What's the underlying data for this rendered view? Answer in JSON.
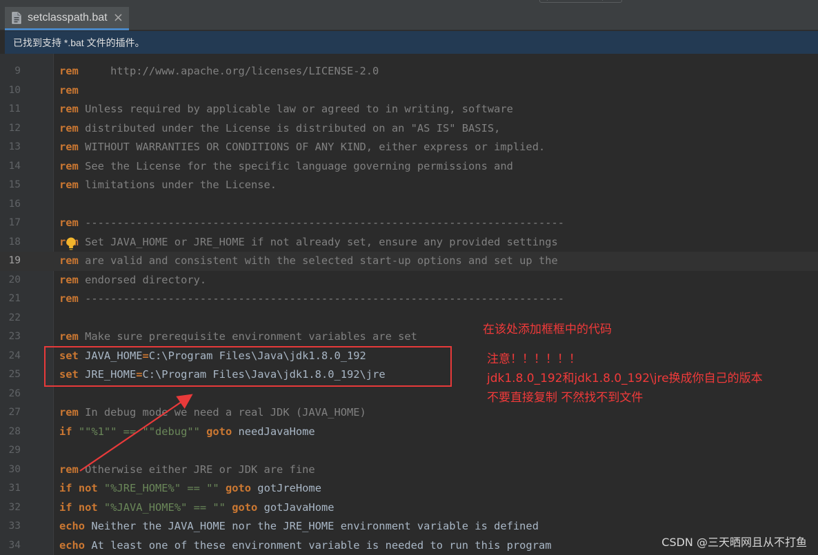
{
  "tab": {
    "label": "setclasspath.bat",
    "close_label": "×"
  },
  "banner": {
    "text": "已找到支持 *.bat 文件的插件。"
  },
  "editor": {
    "current_line": 19,
    "lines": [
      {
        "n": "9",
        "code": [
          [
            "k",
            "rem"
          ],
          [
            "c",
            "     http://www.apache.org/licenses/LICENSE-2.0"
          ]
        ]
      },
      {
        "n": "10",
        "code": [
          [
            "k",
            "rem"
          ]
        ]
      },
      {
        "n": "11",
        "code": [
          [
            "k",
            "rem"
          ],
          [
            "c",
            " Unless required by applicable law or agreed to in writing, software"
          ]
        ]
      },
      {
        "n": "12",
        "code": [
          [
            "k",
            "rem"
          ],
          [
            "c",
            " distributed under the License is distributed on an \"AS IS\" BASIS,"
          ]
        ]
      },
      {
        "n": "13",
        "code": [
          [
            "k",
            "rem"
          ],
          [
            "c",
            " WITHOUT WARRANTIES OR CONDITIONS OF ANY KIND, either express or implied."
          ]
        ]
      },
      {
        "n": "14",
        "code": [
          [
            "k",
            "rem"
          ],
          [
            "c",
            " See the License for the specific language governing permissions and"
          ]
        ]
      },
      {
        "n": "15",
        "code": [
          [
            "k",
            "rem"
          ],
          [
            "c",
            " limitations under the License."
          ]
        ]
      },
      {
        "n": "16",
        "code": []
      },
      {
        "n": "17",
        "code": [
          [
            "k",
            "rem"
          ],
          [
            "c",
            " ---------------------------------------------------------------------------"
          ]
        ]
      },
      {
        "n": "18",
        "code": [
          [
            "k",
            "rem"
          ],
          [
            "c",
            " Set JAVA_HOME or JRE_HOME if not already set, ensure any provided settings"
          ]
        ]
      },
      {
        "n": "19",
        "code": [
          [
            "k",
            "rem"
          ],
          [
            "c",
            " are valid and consistent with the selected start-up options and set up the"
          ]
        ]
      },
      {
        "n": "20",
        "code": [
          [
            "k",
            "rem"
          ],
          [
            "c",
            " endorsed directory."
          ]
        ]
      },
      {
        "n": "21",
        "code": [
          [
            "k",
            "rem"
          ],
          [
            "c",
            " ---------------------------------------------------------------------------"
          ]
        ]
      },
      {
        "n": "22",
        "code": []
      },
      {
        "n": "23",
        "code": [
          [
            "k",
            "rem"
          ],
          [
            "c",
            " Make sure prerequisite environment variables are set"
          ]
        ]
      },
      {
        "n": "24",
        "code": [
          [
            "k",
            "set"
          ],
          [
            "p",
            " JAVA_HOME"
          ],
          [
            "k",
            "="
          ],
          [
            "p",
            "C:\\Program Files\\Java\\jdk1.8.0_192"
          ]
        ]
      },
      {
        "n": "25",
        "code": [
          [
            "k",
            "set"
          ],
          [
            "p",
            " JRE_HOME"
          ],
          [
            "k",
            "="
          ],
          [
            "p",
            "C:\\Program Files\\Java\\jdk1.8.0_192\\jre"
          ]
        ]
      },
      {
        "n": "26",
        "code": []
      },
      {
        "n": "27",
        "code": [
          [
            "k",
            "rem"
          ],
          [
            "c",
            " In debug mode we need a real JDK (JAVA_HOME)"
          ]
        ]
      },
      {
        "n": "28",
        "code": [
          [
            "k",
            "if"
          ],
          [
            "s",
            " \"\"%1\"\" == \"\"debug\"\" "
          ],
          [
            "k",
            "goto"
          ],
          [
            "p",
            " needJavaHome"
          ]
        ]
      },
      {
        "n": "29",
        "code": []
      },
      {
        "n": "30",
        "code": [
          [
            "k",
            "rem"
          ],
          [
            "c",
            " Otherwise either JRE or JDK are fine"
          ]
        ]
      },
      {
        "n": "31",
        "code": [
          [
            "k",
            "if"
          ],
          [
            "k",
            " not"
          ],
          [
            "s",
            " \"%JRE_HOME%\" == \"\" "
          ],
          [
            "k",
            "goto"
          ],
          [
            "p",
            " gotJreHome"
          ]
        ]
      },
      {
        "n": "32",
        "code": [
          [
            "k",
            "if"
          ],
          [
            "k",
            " not"
          ],
          [
            "s",
            " \"%JAVA_HOME%\" == \"\" "
          ],
          [
            "k",
            "goto"
          ],
          [
            "p",
            " gotJavaHome"
          ]
        ]
      },
      {
        "n": "33",
        "code": [
          [
            "k",
            "echo"
          ],
          [
            "p",
            " Neither the JAVA_HOME nor the JRE_HOME environment variable is defined"
          ]
        ]
      },
      {
        "n": "34",
        "code": [
          [
            "k",
            "echo"
          ],
          [
            "p",
            " At least one of these environment variable is needed to run this program"
          ]
        ]
      }
    ]
  },
  "annotations": {
    "title": "在该处添加框框中的代码",
    "note_line1": "注意！！！！！！",
    "note_line2": "jdk1.8.0_192和jdk1.8.0_192\\jre换成你自己的版本",
    "note_line3": "不要直接复制 不然找不到文件"
  },
  "watermark": "CSDN @三天晒网且从不打鱼",
  "colors": {
    "keyword": "#cc7832",
    "comment": "#808080",
    "string": "#6a8759",
    "plain": "#a9b7c6",
    "annotation": "#f13a3a",
    "banner_bg": "#233a53"
  }
}
